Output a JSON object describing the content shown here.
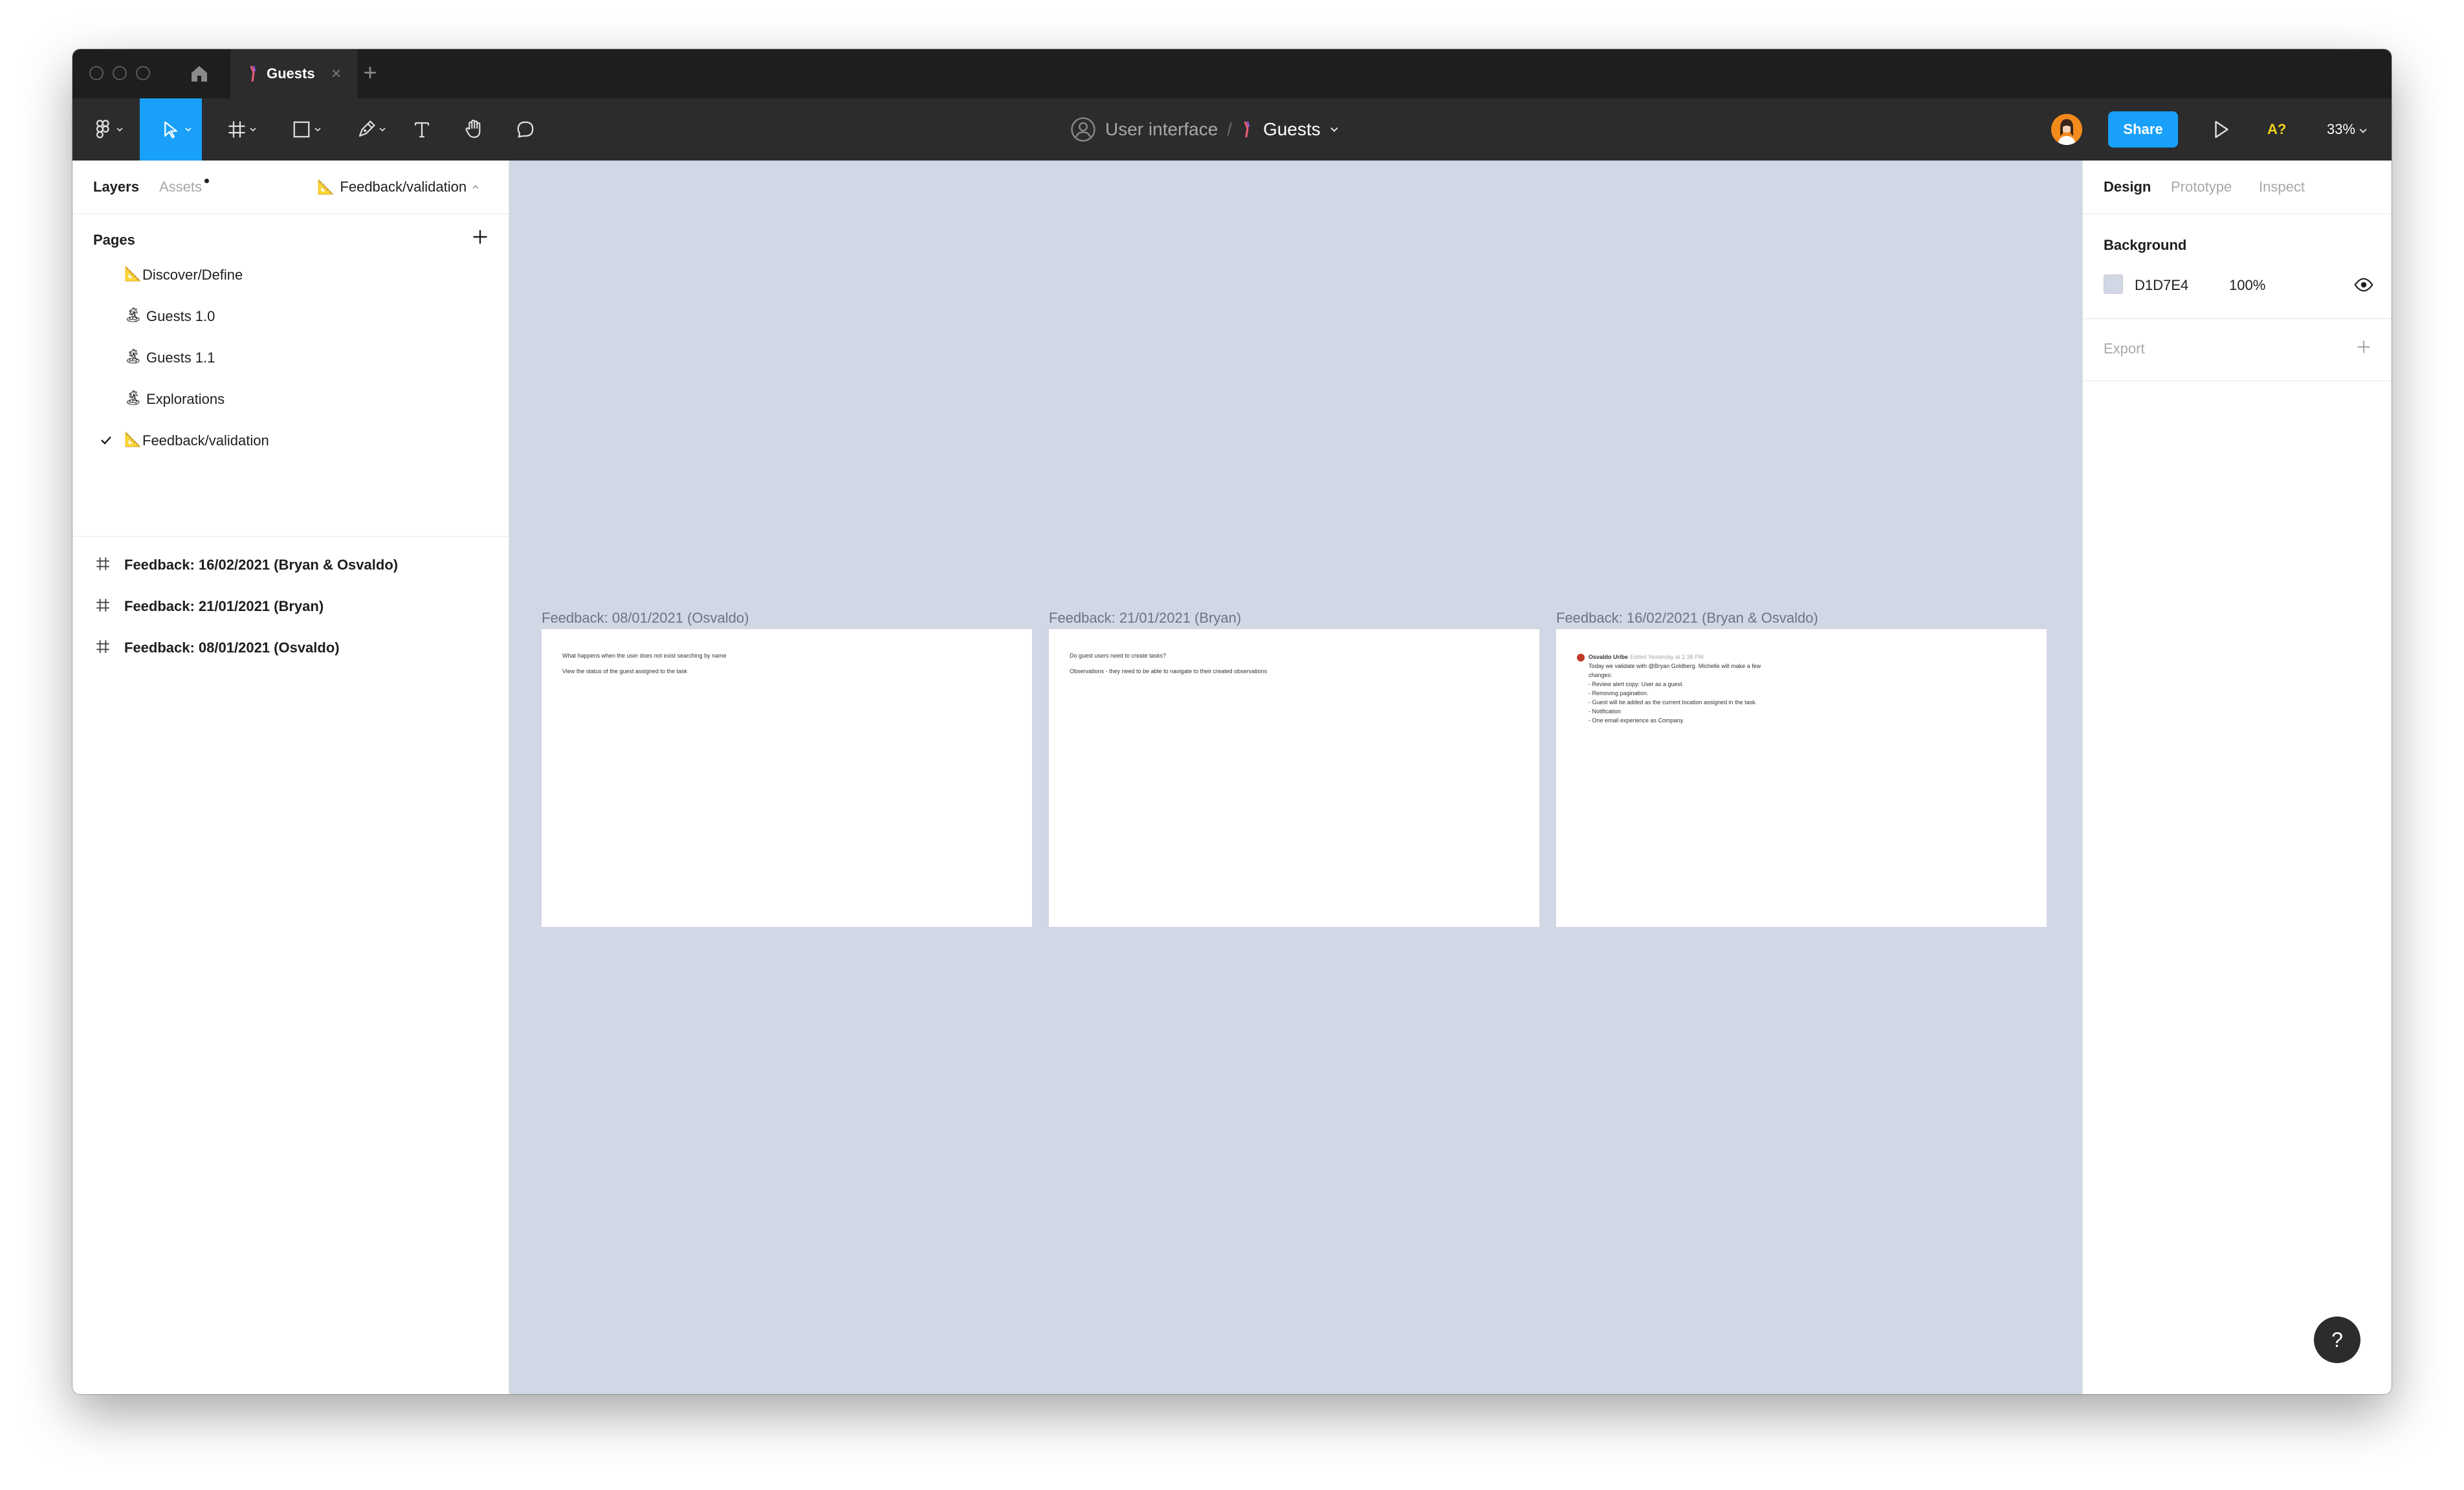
{
  "titlebar": {
    "tab_label": "Guests",
    "tab_close": "×",
    "new_tab": "+"
  },
  "toolbar": {
    "breadcrumb_team": "User interface",
    "breadcrumb_sep": "/",
    "breadcrumb_file": "Guests",
    "share_label": "Share",
    "a11y_label": "A?",
    "zoom_label": "33%",
    "accent_color": "#18a0fb"
  },
  "left_panel": {
    "tab_layers": "Layers",
    "tab_assets": "Assets",
    "current_page": "Feedback/validation",
    "pages_header": "Pages",
    "pages": [
      {
        "label": "Discover/Define",
        "icon": "triangle-ruler-icon"
      },
      {
        "label": "Guests 1.0",
        "icon": "palm-tree-icon"
      },
      {
        "label": "Guests 1.1",
        "icon": "palm-tree-icon"
      },
      {
        "label": "Explorations",
        "icon": "palm-tree-icon"
      },
      {
        "label": "Feedback/validation",
        "icon": "triangle-ruler-icon",
        "selected": true
      }
    ],
    "layers": [
      {
        "label": "Feedback: 16/02/2021 (Bryan & Osvaldo)"
      },
      {
        "label": "Feedback: 21/01/2021 (Bryan)"
      },
      {
        "label": "Feedback: 08/01/2021 (Osvaldo)"
      }
    ]
  },
  "canvas": {
    "background": "#d1d7e4",
    "frames": [
      {
        "title": "Feedback: 08/01/2021 (Osvaldo)",
        "lines": [
          "What happens when the user does not exist searching by name",
          "View the status of the guest assigned to the task"
        ]
      },
      {
        "title": "Feedback: 21/01/2021 (Bryan)",
        "lines": [
          "Do guest users need to create tasks?",
          "Observations - they need to be able to navigate to their created observations"
        ]
      },
      {
        "title": "Feedback: 16/02/2021 (Bryan & Osvaldo)",
        "comment_author": "Osvaldo Uribe",
        "comment_meta": "Edited Yesterday at 1:38 PM",
        "lines": [
          "Today we validate with @Bryan Goldberg. Michelle will make a few",
          "changes:",
          "- Review alert copy: User as a guest.",
          "- Removing pagination.",
          "- Guest will be added as the current location assigned in the task.",
          "- Notification",
          "- One email experience as Company."
        ]
      }
    ]
  },
  "right_panel": {
    "tab_design": "Design",
    "tab_prototype": "Prototype",
    "tab_inspect": "Inspect",
    "background_header": "Background",
    "background_hex": "D1D7E4",
    "background_color": "#d1d7e4",
    "background_opacity": "100%",
    "export_header": "Export"
  },
  "help": {
    "label": "?"
  }
}
